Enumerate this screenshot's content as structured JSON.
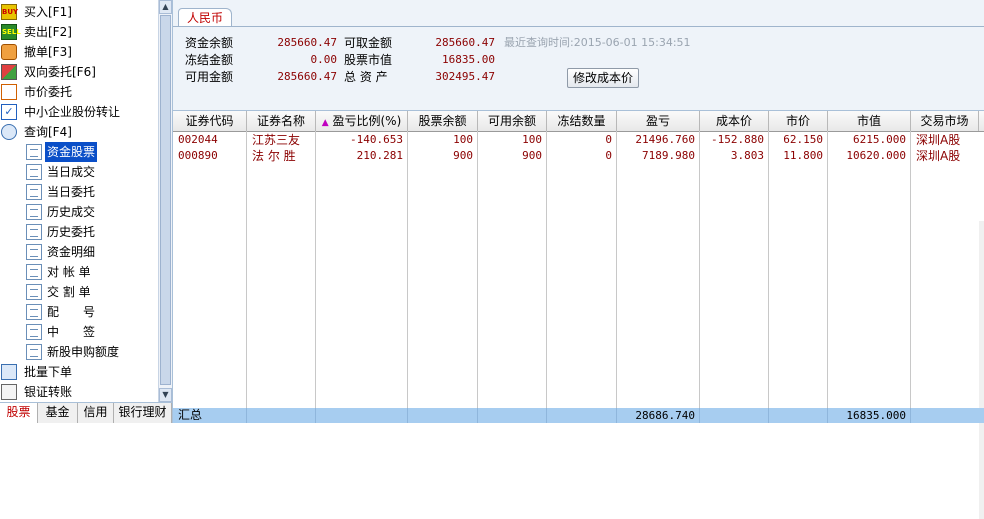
{
  "nav": {
    "items": [
      {
        "label": "买入[F1]",
        "icon": "buy-icon",
        "icon_text": "BUY"
      },
      {
        "label": "卖出[F2]",
        "icon": "sell-icon",
        "icon_text": "SELL"
      },
      {
        "label": "撤单[F3]",
        "icon": "hand-icon"
      },
      {
        "label": "双向委托[F6]",
        "icon": "two-way-order-icon"
      },
      {
        "label": "市价委托",
        "icon": "market-order-icon"
      },
      {
        "label": "中小企业股份转让",
        "icon": "checkmark-icon",
        "icon_text": "✓"
      },
      {
        "label": "查询[F4]",
        "icon": "magnifier-icon"
      },
      {
        "label": "资金股票",
        "icon": "document-icon",
        "selected": true
      },
      {
        "label": "当日成交",
        "icon": "document-icon"
      },
      {
        "label": "当日委托",
        "icon": "document-icon"
      },
      {
        "label": "历史成交",
        "icon": "document-icon"
      },
      {
        "label": "历史委托",
        "icon": "document-icon"
      },
      {
        "label": "资金明细",
        "icon": "document-icon"
      },
      {
        "label": "对 帐 单",
        "icon": "document-icon"
      },
      {
        "label": "交 割 单",
        "icon": "document-icon"
      },
      {
        "label": "配　　号",
        "icon": "document-icon"
      },
      {
        "label": "中　　签",
        "icon": "document-icon"
      },
      {
        "label": "新股申购额度",
        "icon": "document-icon"
      },
      {
        "label": "批量下单",
        "icon": "batch-order-icon"
      },
      {
        "label": "银证转账",
        "icon": "bank-transfer-icon"
      }
    ],
    "bottom_tabs": [
      "股票",
      "基金",
      "信用",
      "银行理财"
    ]
  },
  "account": {
    "currency_tab": "人民币",
    "fields": [
      {
        "label": "资金余额",
        "value": "285660.47"
      },
      {
        "label": "冻结金额",
        "value": "0.00"
      },
      {
        "label": "可用金额",
        "value": "285660.47"
      },
      {
        "label": "可取金额",
        "value": "285660.47"
      },
      {
        "label": "股票市值",
        "value": "16835.00"
      },
      {
        "label": "总 资 产",
        "value": "302495.47"
      }
    ],
    "query_time": "最近查询时间:2015-06-01 15:34:51",
    "modify_cost_button": "修改成本价"
  },
  "table": {
    "sort_indicator": "▲",
    "columns": [
      "证券代码",
      "证券名称",
      "盈亏比例(%)",
      "股票余额",
      "可用余额",
      "冻结数量",
      "盈亏",
      "成本价",
      "市价",
      "市值",
      "交易市场"
    ],
    "rows": [
      [
        "002044",
        "江苏三友",
        "-140.653",
        "100",
        "100",
        "0",
        "21496.760",
        "-152.880",
        "62.150",
        "6215.000",
        "深圳A股"
      ],
      [
        "000890",
        "法 尔 胜",
        "210.281",
        "900",
        "900",
        "0",
        "7189.980",
        "3.803",
        "11.800",
        "10620.000",
        "深圳A股"
      ]
    ],
    "summary": {
      "label": "汇总",
      "profit": "28686.740",
      "market_value": "16835.000"
    }
  },
  "colors": {
    "value_text": "#8b0000",
    "selected_bg": "#0a4fc8",
    "summary_bg": "#a7cdf0",
    "active_tab_text": "#c00000"
  }
}
